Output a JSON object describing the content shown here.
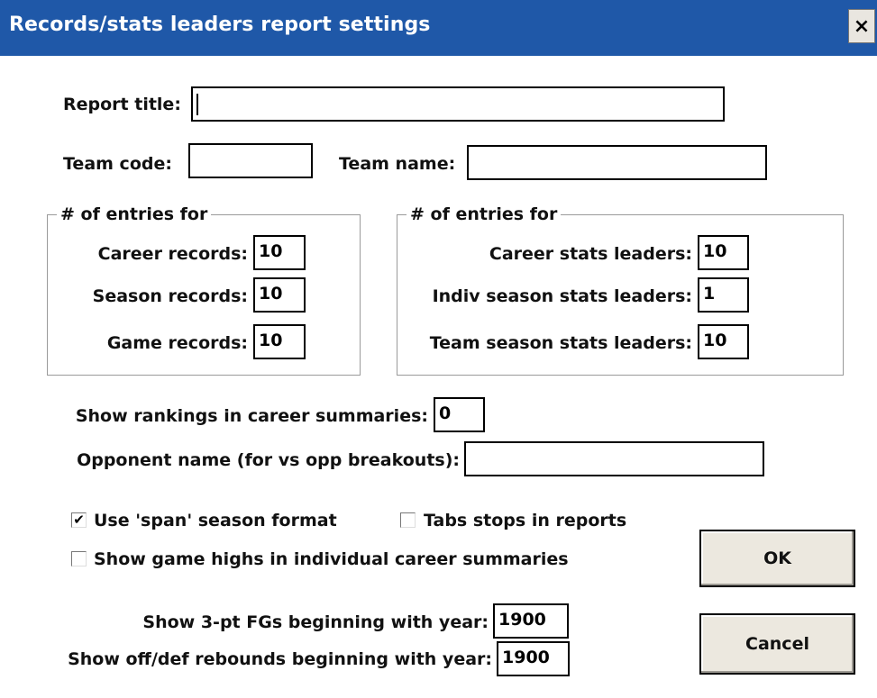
{
  "window": {
    "title": "Records/stats leaders report settings",
    "close_glyph": "×"
  },
  "report_title": {
    "label": "Report title:",
    "value": ""
  },
  "team_code": {
    "label": "Team code:",
    "value": ""
  },
  "team_name": {
    "label": "Team name:",
    "value": ""
  },
  "records_group": {
    "title": "# of entries for",
    "rows": [
      {
        "label": "Career records:",
        "value": "10"
      },
      {
        "label": "Season records:",
        "value": "10"
      },
      {
        "label": "Game records:",
        "value": "10"
      }
    ]
  },
  "leaders_group": {
    "title": "# of entries for",
    "rows": [
      {
        "label": "Career stats leaders:",
        "value": "10"
      },
      {
        "label": "Indiv season stats leaders:",
        "value": "1"
      },
      {
        "label": "Team season stats leaders:",
        "value": "10"
      }
    ]
  },
  "show_rankings": {
    "label": "Show rankings in career summaries:",
    "value": "0"
  },
  "opponent_name": {
    "label": "Opponent name (for vs opp breakouts):",
    "value": ""
  },
  "options": {
    "span_format": {
      "label": "Use 'span' season format",
      "checked": true,
      "glyph": "✔"
    },
    "tab_stops": {
      "label": "Tabs stops in reports",
      "checked": false,
      "glyph": ""
    },
    "game_highs": {
      "label": "Show game highs in individual career summaries",
      "checked": false,
      "glyph": ""
    }
  },
  "three_pt": {
    "label": "Show 3-pt FGs beginning with year:",
    "value": "1900"
  },
  "rebounds": {
    "label": "Show off/def rebounds beginning with year:",
    "value": "1900"
  },
  "buttons": {
    "ok": "OK",
    "cancel": "Cancel"
  }
}
